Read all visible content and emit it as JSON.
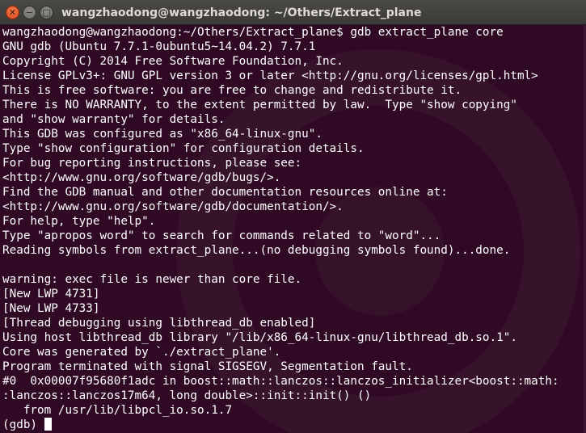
{
  "window": {
    "title": "wangzhaodong@wangzhaodong: ~/Others/Extract_plane",
    "controls": {
      "close_icon": "close-icon",
      "minimize_icon": "minimize-icon",
      "maximize_icon": "maximize-icon"
    }
  },
  "colors": {
    "terminal_bg": "#300a24",
    "terminal_fg": "#ffffff",
    "close_button": "#dc4a1d",
    "titlebar": "#3c3b37"
  },
  "terminal": {
    "lines": [
      "wangzhaodong@wangzhaodong:~/Others/Extract_plane$ gdb extract_plane core",
      "GNU gdb (Ubuntu 7.7.1-0ubuntu5~14.04.2) 7.7.1",
      "Copyright (C) 2014 Free Software Foundation, Inc.",
      "License GPLv3+: GNU GPL version 3 or later <http://gnu.org/licenses/gpl.html>",
      "This is free software: you are free to change and redistribute it.",
      "There is NO WARRANTY, to the extent permitted by law.  Type \"show copying\"",
      "and \"show warranty\" for details.",
      "This GDB was configured as \"x86_64-linux-gnu\".",
      "Type \"show configuration\" for configuration details.",
      "For bug reporting instructions, please see:",
      "<http://www.gnu.org/software/gdb/bugs/>.",
      "Find the GDB manual and other documentation resources online at:",
      "<http://www.gnu.org/software/gdb/documentation/>.",
      "For help, type \"help\".",
      "Type \"apropos word\" to search for commands related to \"word\"...",
      "Reading symbols from extract_plane...(no debugging symbols found)...done.",
      "",
      "warning: exec file is newer than core file.",
      "[New LWP 4731]",
      "[New LWP 4733]",
      "[Thread debugging using libthread_db enabled]",
      "Using host libthread_db library \"/lib/x86_64-linux-gnu/libthread_db.so.1\".",
      "Core was generated by `./extract_plane'.",
      "Program terminated with signal SIGSEGV, Segmentation fault.",
      "#0  0x00007f95680f1adc in boost::math::lanczos::lanczos_initializer<boost::math:",
      ":lanczos::lanczos17m64, long double>::init::init() ()",
      "   from /usr/lib/libpcl_io.so.1.7"
    ],
    "prompt": "(gdb) "
  }
}
